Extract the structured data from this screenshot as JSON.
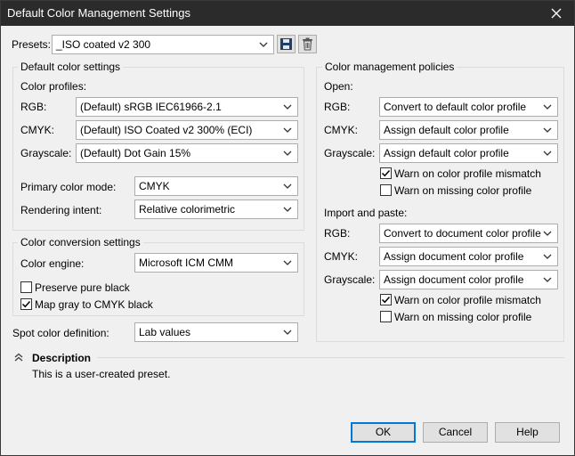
{
  "window": {
    "title": "Default Color Management Settings"
  },
  "presets": {
    "label": "Presets:",
    "value": "_ISO coated v2 300"
  },
  "default_color_settings": {
    "title": "Default color settings",
    "profiles_label": "Color profiles:",
    "rgb_label": "RGB:",
    "rgb_value": "(Default) sRGB IEC61966-2.1",
    "cmyk_label": "CMYK:",
    "cmyk_value": "(Default) ISO Coated v2 300% (ECI)",
    "gray_label": "Grayscale:",
    "gray_value": "(Default) Dot Gain 15%",
    "primary_label": "Primary color mode:",
    "primary_value": "CMYK",
    "intent_label": "Rendering intent:",
    "intent_value": "Relative colorimetric"
  },
  "conversion": {
    "title": "Color conversion settings",
    "engine_label": "Color engine:",
    "engine_value": "Microsoft ICM CMM",
    "preserve_black": {
      "label": "Preserve pure black",
      "checked": false
    },
    "map_gray": {
      "label": "Map gray to CMYK black",
      "checked": true
    }
  },
  "spot": {
    "label": "Spot color definition:",
    "value": "Lab values"
  },
  "policies": {
    "title": "Color management policies",
    "open": {
      "label": "Open:",
      "rgb_label": "RGB:",
      "rgb_value": "Convert to default color profile",
      "cmyk_label": "CMYK:",
      "cmyk_value": "Assign default color profile",
      "gray_label": "Grayscale:",
      "gray_value": "Assign default color profile",
      "warn_mismatch": {
        "label": "Warn on color profile mismatch",
        "checked": true
      },
      "warn_missing": {
        "label": "Warn on missing color profile",
        "checked": false
      }
    },
    "import": {
      "label": "Import and paste:",
      "rgb_label": "RGB:",
      "rgb_value": "Convert to document color profile",
      "cmyk_label": "CMYK:",
      "cmyk_value": "Assign document color profile",
      "gray_label": "Grayscale:",
      "gray_value": "Assign document color profile",
      "warn_mismatch": {
        "label": "Warn on color profile mismatch",
        "checked": true
      },
      "warn_missing": {
        "label": "Warn on missing color profile",
        "checked": false
      }
    }
  },
  "description": {
    "title": "Description",
    "text": "This is a user-created preset."
  },
  "buttons": {
    "ok": "OK",
    "cancel": "Cancel",
    "help": "Help"
  },
  "icons": {
    "close": "close-icon",
    "save": "save-icon",
    "delete": "trash-icon",
    "collapse": "double-chevron-up-icon",
    "dropdown": "chevron-down-icon",
    "check": "checkmark-icon"
  },
  "colors": {
    "titlebar": "#2b2b2b",
    "accent": "#0078d7",
    "dialog": "#f0f0f0"
  }
}
